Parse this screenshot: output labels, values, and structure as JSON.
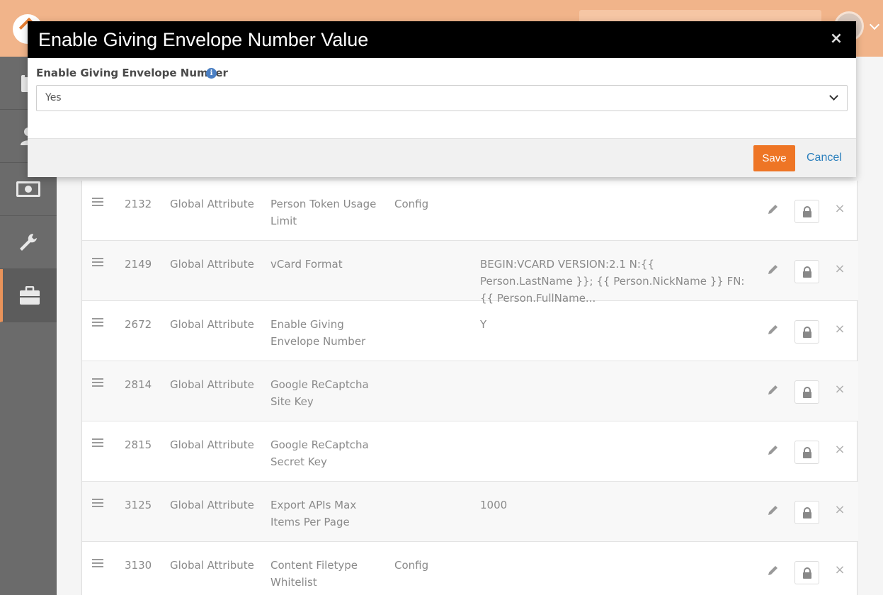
{
  "modal": {
    "title": "Enable Giving Envelope Number Value",
    "close_symbol": "×",
    "field_label": "Enable Giving Envelope Number",
    "info_symbol": "i",
    "select_value": "Yes",
    "save_label": "Save",
    "cancel_label": "Cancel"
  },
  "sidebar": {
    "icons": [
      "clipboard-icon",
      "person-icon",
      "money-icon",
      "wrench-icon",
      "briefcase-icon"
    ],
    "active_index": 4
  },
  "grid": {
    "rows": [
      {
        "id": "2132",
        "type": "Global Attribute",
        "name": "Person Token Usage Limit",
        "category": "Config",
        "value": ""
      },
      {
        "id": "2149",
        "type": "Global Attribute",
        "name": "vCard Format",
        "category": "",
        "value": "BEGIN:VCARD VERSION:2.1 N:{{ Person.LastName }}; {{ Person.NickName }} FN:{{ Person.FullName..."
      },
      {
        "id": "2672",
        "type": "Global Attribute",
        "name": "Enable Giving Envelope Number",
        "category": "",
        "value": "Y"
      },
      {
        "id": "2814",
        "type": "Global Attribute",
        "name": "Google ReCaptcha Site Key",
        "category": "",
        "value": ""
      },
      {
        "id": "2815",
        "type": "Global Attribute",
        "name": "Google ReCaptcha Secret Key",
        "category": "",
        "value": ""
      },
      {
        "id": "3125",
        "type": "Global Attribute",
        "name": "Export APIs Max Items Per Page",
        "category": "",
        "value": "1000"
      },
      {
        "id": "3130",
        "type": "Global Attribute",
        "name": "Content Filetype Whitelist",
        "category": "Config",
        "value": ""
      }
    ],
    "delete_symbol": "×"
  },
  "colors": {
    "topbar": "#f1b48a",
    "accent": "#ee7525",
    "link": "#2a7fbd",
    "sidebar": "#6b6b6b"
  }
}
